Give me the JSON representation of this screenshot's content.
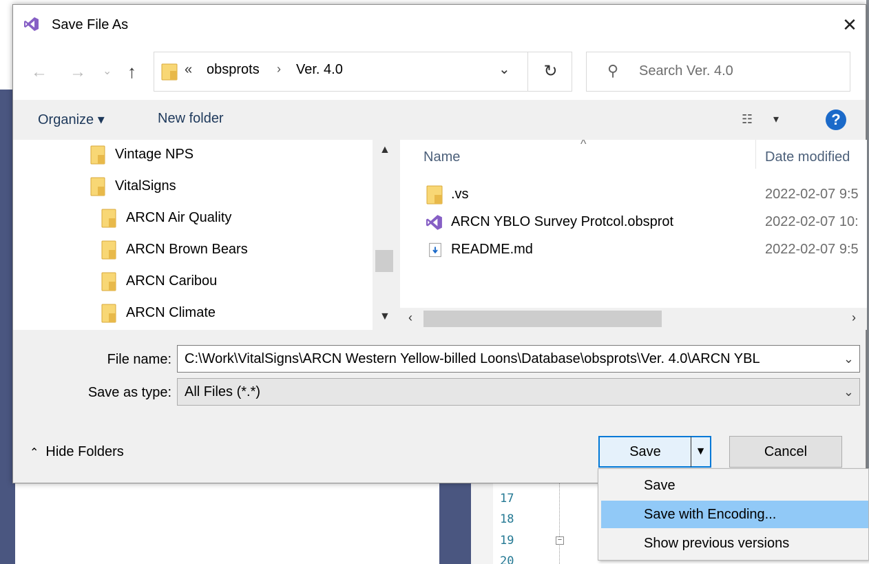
{
  "background_editor": {
    "line_numbers": [
      "17",
      "18",
      "19",
      "20"
    ]
  },
  "dialog": {
    "title": "Save File As",
    "title_icon": "visual-studio-icon",
    "close_glyph": "✕",
    "nav": {
      "back_glyph": "←",
      "forward_glyph": "→",
      "recent_glyph": "⌄",
      "up_glyph": "↑",
      "address": {
        "overflow_glyph": "«",
        "segments": [
          "obsprots",
          "Ver. 4.0"
        ],
        "separator": "›",
        "dropdown_glyph": "⌄",
        "refresh_glyph": "↻"
      },
      "search_placeholder": "Search Ver. 4.0"
    },
    "toolbar": {
      "organize_label": "Organize ▾",
      "new_folder_label": "New folder",
      "view_glyph": "☷",
      "view_dropdown_glyph": "▾",
      "help_glyph": "?"
    },
    "tree": {
      "items": [
        {
          "label": "Vintage NPS",
          "level": 1
        },
        {
          "label": "VitalSigns",
          "level": 1
        },
        {
          "label": "ARCN Air Quality",
          "level": 2
        },
        {
          "label": "ARCN Brown Bears",
          "level": 2
        },
        {
          "label": "ARCN Caribou",
          "level": 2
        },
        {
          "label": "ARCN Climate",
          "level": 2
        }
      ]
    },
    "file_list": {
      "columns": {
        "name": "Name",
        "date": "Date modified"
      },
      "files": [
        {
          "name": ".vs",
          "date": "2022-02-07 9:5",
          "icon": "folder-icon"
        },
        {
          "name": "ARCN YBLO Survey Protcol.obsprot",
          "date": "2022-02-07 10:",
          "icon": "visual-studio-icon"
        },
        {
          "name": "README.md",
          "date": "2022-02-07 9:5",
          "icon": "document-icon"
        }
      ]
    },
    "form": {
      "file_name_label": "File name:",
      "file_name_value": "C:\\Work\\VitalSigns\\ARCN Western Yellow-billed Loons\\Database\\obsprots\\Ver. 4.0\\ARCN YBL",
      "save_type_label": "Save as type:",
      "save_type_value": "All Files (*.*)"
    },
    "footer": {
      "hide_folders_label": "Hide Folders",
      "save_label": "Save",
      "cancel_label": "Cancel"
    }
  },
  "save_menu": {
    "items": [
      {
        "label": "Save",
        "highlighted": false
      },
      {
        "label": "Save with Encoding...",
        "highlighted": true
      },
      {
        "label": "Show previous versions",
        "highlighted": false
      }
    ]
  },
  "colors": {
    "accent": "#0078d7",
    "menu_highlight": "#91c9f7",
    "folder_yellow": "#f8d775",
    "vs_purple": "#865fc5",
    "help_blue": "#1b6ac9"
  }
}
